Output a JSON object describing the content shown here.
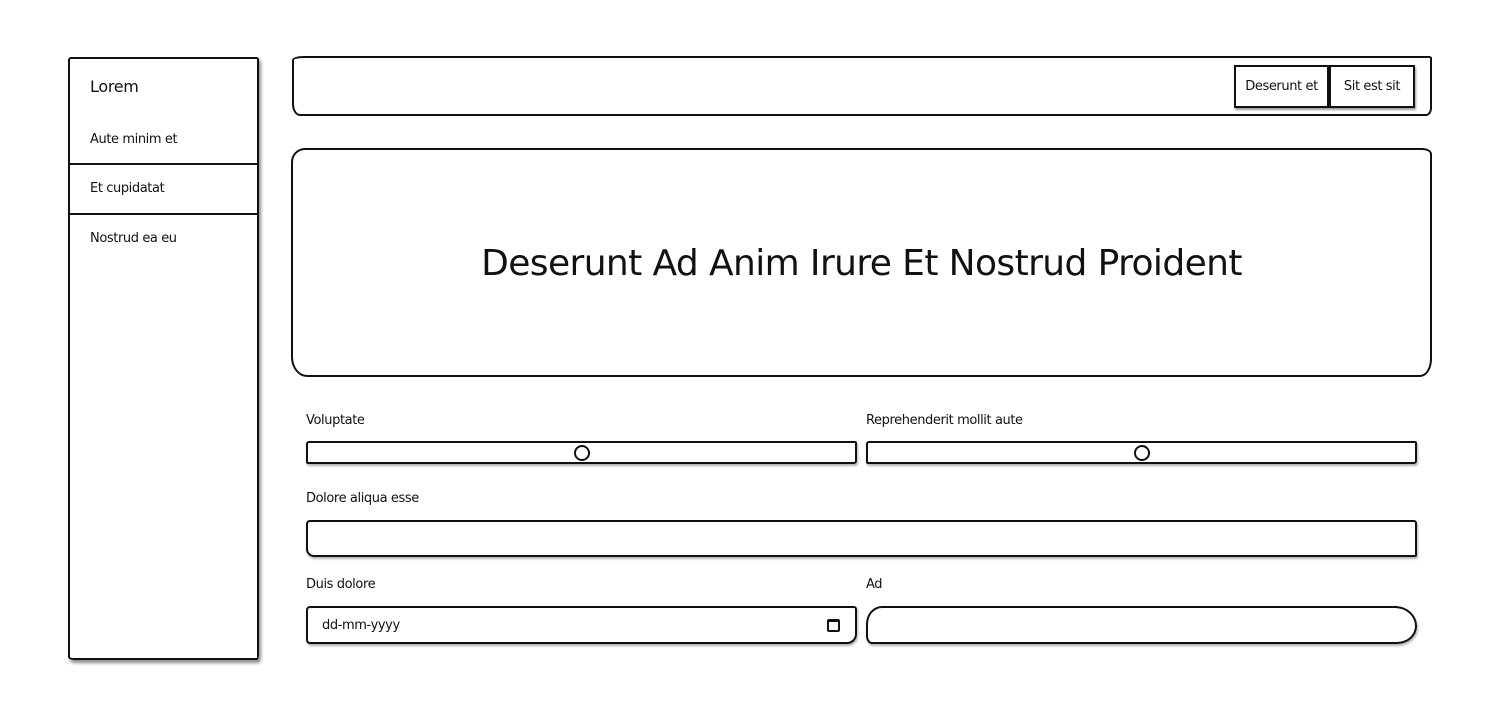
{
  "sidebar": {
    "title": "Lorem",
    "items": [
      {
        "label": "Aute minim et"
      },
      {
        "label": "Et cupidatat"
      },
      {
        "label": "Nostrud ea eu"
      }
    ]
  },
  "header": {
    "buttons": [
      {
        "label": "Deserunt et"
      },
      {
        "label": "Sit est sit"
      }
    ]
  },
  "hero": {
    "title": "Deserunt Ad Anim Irure Et Nostrud Proident"
  },
  "form": {
    "slider1": {
      "label": "Voluptate",
      "value_fraction": 0.5
    },
    "slider2": {
      "label": "Reprehenderit mollit aute",
      "value_fraction": 0.5
    },
    "text1": {
      "label": "Dolore aliqua esse",
      "value": ""
    },
    "date": {
      "label": "Duis dolore",
      "placeholder": "dd-mm-yyyy",
      "icon": "calendar-icon"
    },
    "text2": {
      "label": "Ad",
      "value": ""
    }
  }
}
